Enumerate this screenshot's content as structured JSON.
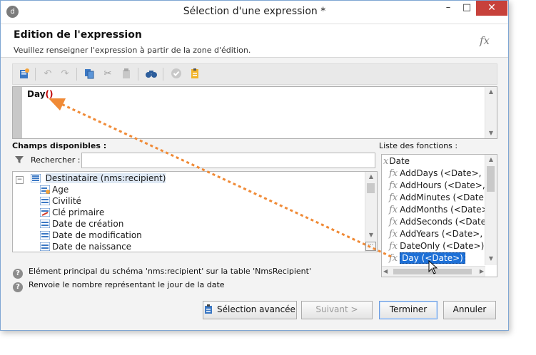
{
  "window": {
    "title": "Sélection d'une expression *",
    "app_icon_glyph": "d"
  },
  "header": {
    "title": "Edition de l'expression",
    "subtitle": "Veuillez renseigner l'expression à partir de la zone d'édition.",
    "logo": "fx"
  },
  "toolbar": {
    "icons": [
      "insert-field-icon",
      "undo-icon",
      "redo-icon",
      "copy-icon",
      "cut-icon",
      "paste-icon",
      "find-icon",
      "validate-icon",
      "clipboard-icon"
    ]
  },
  "editor": {
    "expr_name": "Day",
    "expr_parens": "()"
  },
  "fields": {
    "heading": "Champs disponibles :",
    "search_label": "Rechercher :",
    "search_value": "",
    "tree": {
      "root": "Destinataire (nms:recipient)",
      "items": [
        "Age",
        "Civilité",
        "Clé primaire",
        "Date de création",
        "Date de modification",
        "Date de naissance"
      ]
    }
  },
  "functions": {
    "heading": "Liste des fonctions :",
    "category": "Date",
    "items": [
      "AddDays (<Date>, <N",
      "AddHours (<Date>, <N",
      "AddMinutes (<Date>,",
      "AddMonths (<Date>,",
      "AddSeconds (<Date>,",
      "AddYears (<Date>, <N",
      "DateOnly (<Date>)"
    ],
    "selected": "Day (<Date>)"
  },
  "info": {
    "line1": "Elément principal du schéma 'nms:recipient' sur la table 'NmsRecipient'",
    "line2": "Renvoie le nombre représentant le jour de la date"
  },
  "buttons": {
    "advanced": "Sélection avancée",
    "next": "Suivant >",
    "finish": "Terminer",
    "cancel": "Annuler"
  },
  "colors": {
    "accent": "#1c6fd6",
    "drag_arrow": "#f08a36",
    "close_button": "#c7413b"
  }
}
